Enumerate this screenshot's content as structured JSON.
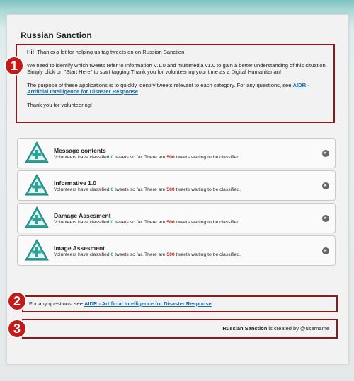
{
  "app": {
    "title": "Russian Sanction"
  },
  "intro": {
    "hi": "Hi!",
    "greeting": "Thanks a lot for helping us tag tweets on on Russian Sanction.",
    "paragraph1": "We need to identify which tweets refer to Information V.1.0 and multimedia v1.0 to gain a better understanding of this situation. Simply click on \"Start Here\" to start tagging.Thank you for volunteering your time as a Digital Humanitarian!",
    "paragraph2_prefix": "The purpose of these applications is to quickly identify tweets relevant to each category. For any questions, see ",
    "link_text": "AIDR - Artificial Intelligence for Disaster Response",
    "closing": "Thank you for volunteering!"
  },
  "markers": {
    "m1": "1",
    "m2": "2",
    "m3": "3"
  },
  "tasks": [
    {
      "name": "Message contents",
      "desc_prefix": "Volunteers have classified ",
      "classified": "0",
      "desc_middle": " tweets so far. There are ",
      "waiting": "500",
      "desc_suffix": " tweets waiting to be classified."
    },
    {
      "name": "Informative 1.0",
      "desc_prefix": "Volunteers have classified ",
      "classified": "0",
      "desc_middle": " tweets so far. There are ",
      "waiting": "500",
      "desc_suffix": " tweets waiting to be classified."
    },
    {
      "name": "Damage Assesment",
      "desc_prefix": "Volunteers have classified ",
      "classified": "0",
      "desc_middle": " tweets so far. There are ",
      "waiting": "500",
      "desc_suffix": " tweets waiting to be classified."
    },
    {
      "name": "Image Assesment",
      "desc_prefix": "Volunteers have classified ",
      "classified": "0",
      "desc_middle": " tweets so far. There are ",
      "waiting": "500",
      "desc_suffix": " tweets waiting to be classified."
    }
  ],
  "questions": {
    "prefix": "For any questions, see ",
    "link_text": "AIDR - Artificial Intelligence for Disaster Response"
  },
  "credit": {
    "app_name": "Russian Sanction",
    "suffix": " is created by @username"
  },
  "colors": {
    "marker": "#c41a1a",
    "annotation_border": "#8b1a1a",
    "link": "#1a6ea8",
    "count_classified": "#1aa3a3",
    "count_waiting": "#b22222",
    "task_icon": "#2aa39a"
  },
  "icons": {
    "task": "triangle-plus-icon",
    "arrow": "chevron-right-circle-icon"
  }
}
